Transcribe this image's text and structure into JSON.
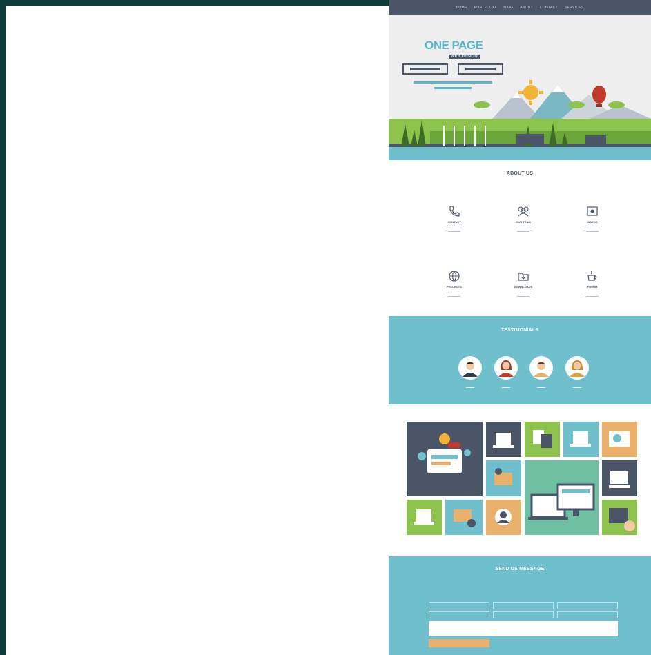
{
  "nav": {
    "items": [
      "Home",
      "Portfolio",
      "Blog",
      "About",
      "Contact",
      "Services"
    ]
  },
  "hero": {
    "title": "ONE PAGE",
    "subtitle": "WEB DESIGN"
  },
  "about": {
    "title": "ABOUT US",
    "features": [
      {
        "label": "CONTACT",
        "icon": "phone-icon"
      },
      {
        "label": "OUR TEAM",
        "icon": "team-icon"
      },
      {
        "label": "VIDEOS",
        "icon": "video-icon"
      },
      {
        "label": "PROJECTS",
        "icon": "globe-icon"
      },
      {
        "label": "DOWNLOADS",
        "icon": "download-icon"
      },
      {
        "label": "FORUM",
        "icon": "coffee-icon"
      }
    ]
  },
  "testimonials": {
    "title": "TESTIMONIALS"
  },
  "contact": {
    "title": "SEND US MESSAGE"
  },
  "colors": {
    "navy": "#4a5568",
    "teal": "#6fc0cc",
    "orange": "#e8b06b",
    "green": "#8dc24d",
    "dark_bg": "#0d3d3a"
  }
}
